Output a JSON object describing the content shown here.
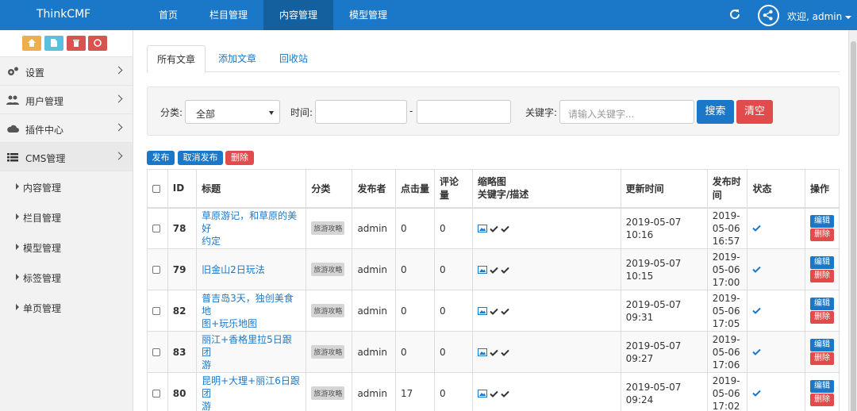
{
  "brand": "ThinkCMF",
  "topnav": [
    "首页",
    "栏目管理",
    "内容管理",
    "模型管理"
  ],
  "user": "欢迎, admin",
  "sidebar": {
    "shortcuts": [
      {
        "icon": "home-icon",
        "color": "#f0ad4e"
      },
      {
        "icon": "file-icon",
        "color": "#5bc0de"
      },
      {
        "icon": "trash-icon",
        "color": "#d9534f"
      },
      {
        "icon": "recycle-icon",
        "color": "#d9534f"
      }
    ],
    "items": [
      {
        "label": "设置",
        "icon": "gears-icon"
      },
      {
        "label": "用户管理",
        "icon": "users-icon"
      },
      {
        "label": "插件中心",
        "icon": "cloud-icon"
      },
      {
        "label": "CMS管理",
        "icon": "list-icon"
      }
    ],
    "sub_items": [
      "内容管理",
      "栏目管理",
      "模型管理",
      "标签管理",
      "单页管理"
    ]
  },
  "tabs": [
    "所有文章",
    "添加文章",
    "回收站"
  ],
  "filter": {
    "category_label": "分类:",
    "category_value": "全部",
    "time_label": "时间:",
    "time_sep": "-",
    "keyword_label": "关键字:",
    "keyword_placeholder": "请输入关键字...",
    "search": "搜索",
    "clear": "清空"
  },
  "actions": {
    "publish": "发布",
    "unpublish": "取消发布",
    "delete": "删除"
  },
  "table": {
    "headers": [
      "ID",
      "标题",
      "分类",
      "发布者",
      "点击量",
      "评论量",
      "缩略图",
      "关键字/描述",
      "更新时间",
      "发布时间",
      "状态",
      "操作"
    ],
    "edit_label": "编辑",
    "delete_label": "删除",
    "rows": [
      {
        "id": "78",
        "title": [
          "草原游记，和草原的美好",
          "约定"
        ],
        "category": "旅游攻略",
        "author": "admin",
        "clicks": "0",
        "comments": "0",
        "updated": [
          "2019-05-07",
          "10:16"
        ],
        "published": [
          "2019-05-06",
          "16:57"
        ]
      },
      {
        "id": "79",
        "title": [
          "旧金山2日玩法"
        ],
        "category": "旅游攻略",
        "author": "admin",
        "clicks": "0",
        "comments": "0",
        "updated": [
          "2019-05-07",
          "10:15"
        ],
        "published": [
          "2019-05-06",
          "17:00"
        ]
      },
      {
        "id": "82",
        "title": [
          "普吉岛3天，独创美食地",
          "图+玩乐地图"
        ],
        "category": "旅游攻略",
        "author": "admin",
        "clicks": "0",
        "comments": "0",
        "updated": [
          "2019-05-07",
          "09:31"
        ],
        "published": [
          "2019-05-06",
          "17:05"
        ]
      },
      {
        "id": "83",
        "title": [
          "丽江+香格里拉5日跟团",
          "游"
        ],
        "category": "旅游攻略",
        "author": "admin",
        "clicks": "0",
        "comments": "0",
        "updated": [
          "2019-05-07",
          "09:27"
        ],
        "published": [
          "2019-05-06",
          "17:06"
        ]
      },
      {
        "id": "80",
        "title": [
          "昆明+大理+丽江6日跟团",
          "游"
        ],
        "category": "旅游攻略",
        "author": "admin",
        "clicks": "17",
        "comments": "0",
        "updated": [
          "2019-05-07",
          "09:24"
        ],
        "published": [
          "2019-05-06",
          "17:02"
        ]
      }
    ]
  }
}
